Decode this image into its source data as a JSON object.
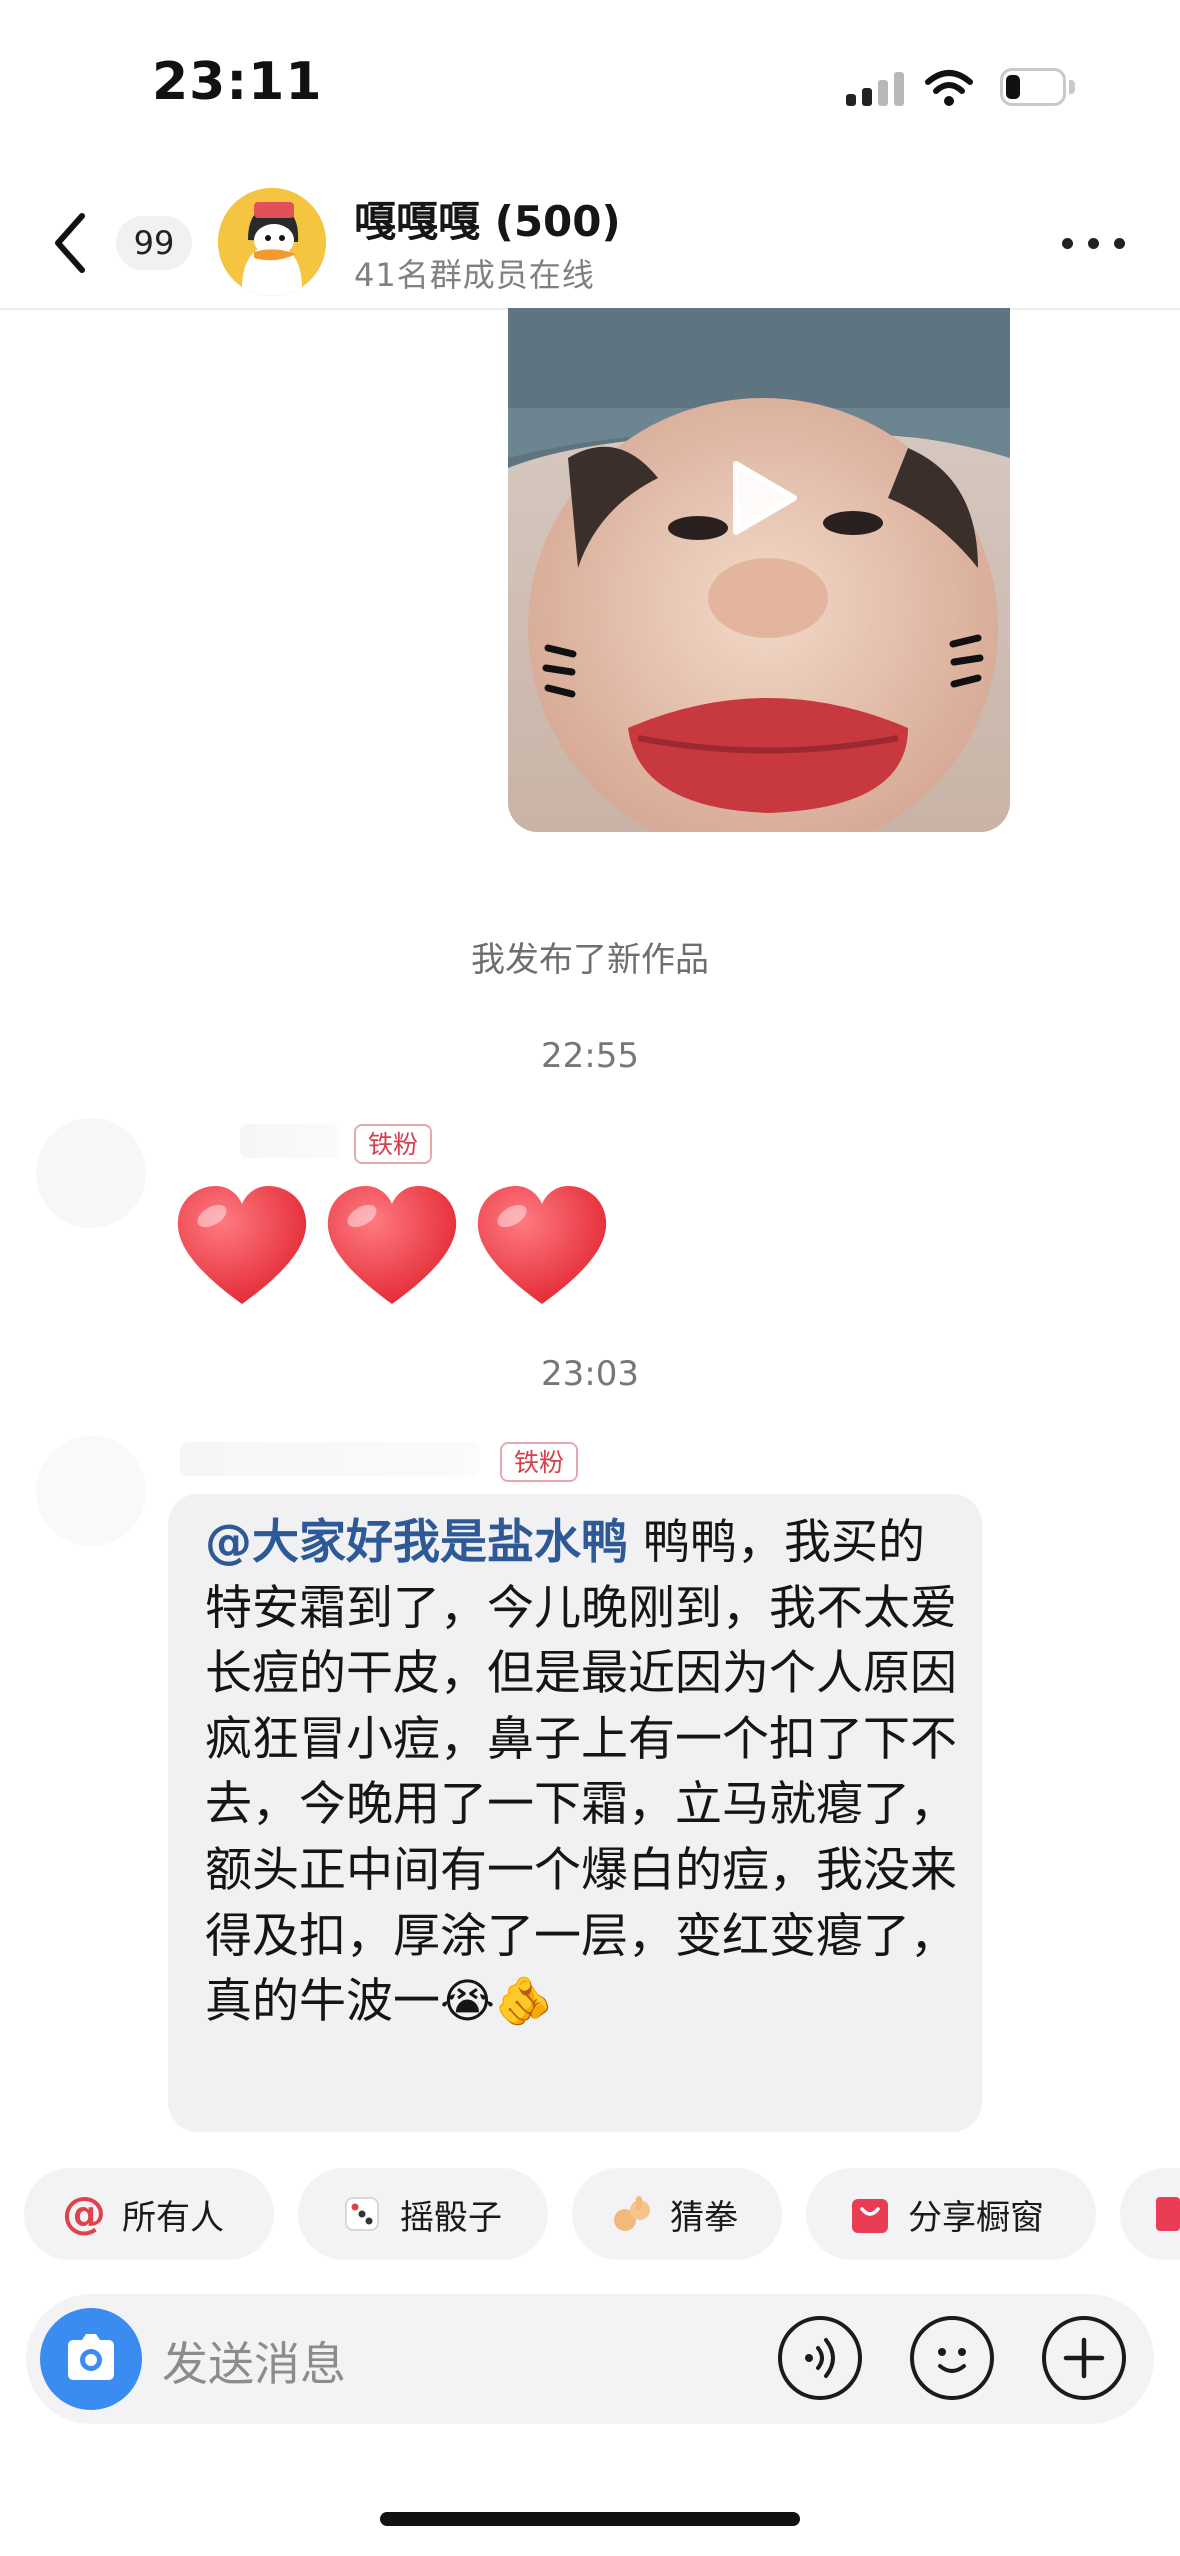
{
  "status_bar": {
    "time": "23:11"
  },
  "header": {
    "unread_count": "99",
    "group_name": "嘎嘎嘎 (500)",
    "online_members": "41名群成员在线"
  },
  "messages": {
    "system_notice": "我发布了新作品",
    "time_1": "22:55",
    "fan_badge_1": "铁粉",
    "time_2": "23:03",
    "fan_badge_2": "铁粉",
    "text_mention": "@大家好我是盐水鸭",
    "text_body": " 鸭鸭，我买的特安霜到了，今儿晚刚到，我不太爱长痘的干皮，但是最近因为个人原因疯狂冒小痘，鼻子上有一个扣了下不去，今晚用了一下霜，立马就瘪了，额头正中间有一个爆白的痘，我没来得及扣，厚涂了一层，变红变瘪了，真的牛波一😭🫵"
  },
  "quick_actions": [
    {
      "label": "所有人",
      "icon": "at-icon"
    },
    {
      "label": "摇骰子",
      "icon": "dice-icon"
    },
    {
      "label": "猜拳",
      "icon": "rock-paper-scissors-icon"
    },
    {
      "label": "分享橱窗",
      "icon": "shop-window-icon"
    }
  ],
  "input": {
    "placeholder": "发送消息"
  },
  "colors": {
    "accent_blue": "#3b8cf0",
    "mention_blue": "#2d5a96",
    "fan_badge_red": "#d4414d",
    "heart_red": "#e8343e",
    "chip_bg": "#f3f3f6"
  }
}
